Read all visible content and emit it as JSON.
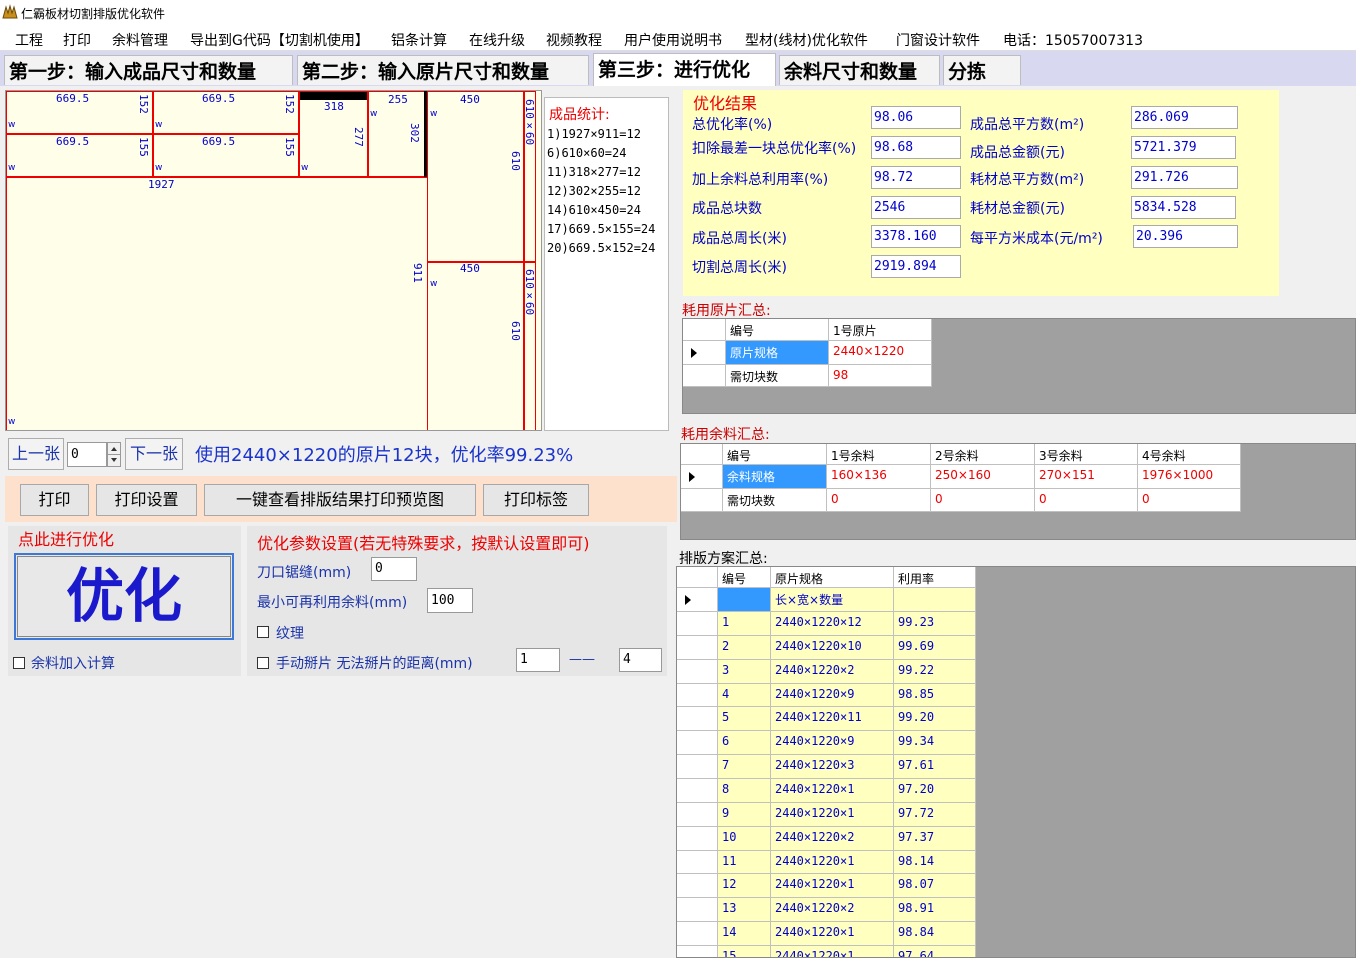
{
  "window": {
    "title": "仁霸板材切割排版优化软件"
  },
  "menu": [
    "工程",
    "打印",
    "余料管理",
    "导出到G代码【切割机使用】",
    "铝条计算",
    "在线升级",
    "视频教程",
    "用户使用说明书",
    "型材(线材)优化软件",
    "门窗设计软件",
    "电话：15057007313"
  ],
  "tabs": [
    "第一步：输入成品尺寸和数量",
    "第二步：输入原片尺寸和数量",
    "第三步：进行优化",
    "余料尺寸和数量",
    "分拣"
  ],
  "layout": {
    "dims": {
      "a": "669.5",
      "b": "152",
      "c": "669.5",
      "d": "152",
      "e": "669.5",
      "f": "155",
      "g": "669.5",
      "h": "155",
      "i": "1927",
      "j": "318",
      "k": "277",
      "l": "255",
      "m": "302",
      "n": "450",
      "o": "610×60",
      "p": "610",
      "q": "911",
      "r": "450",
      "s": "610×60",
      "t": "610"
    }
  },
  "stats": {
    "header": "成品统计:",
    "rows": [
      "1)1927×911=12",
      "6)610×60=24",
      "11)318×277=12",
      "12)302×255=12",
      "14)610×450=24",
      "17)669.5×155=24",
      "20)669.5×152=24"
    ]
  },
  "nav": {
    "prev": "上一张",
    "next": "下一张",
    "page": "0",
    "summary": "使用2440×1220的原片12块，优化率99.23%"
  },
  "print_row": {
    "print": "打印",
    "print_setup": "打印设置",
    "preview": "一键查看排版结果打印预览图",
    "print_label": "打印标签"
  },
  "optimize": {
    "group_label": "点此进行优化",
    "button": "优化",
    "leftover_label": "余料加入计算"
  },
  "params": {
    "title": "优化参数设置(若无特殊要求，按默认设置即可)",
    "kerf_label": "刀口锯缝(mm)",
    "kerf_value": "0",
    "min_reuse_label": "最小可再利用余料(mm)",
    "min_reuse_value": "100",
    "grain_label": "纹理",
    "manual_label": "手动掰片 无法掰片的距离(mm)",
    "manual_from": "1",
    "sep": "——",
    "manual_to": "4"
  },
  "result": {
    "title": "优化结果",
    "items": [
      {
        "label": "总优化率(%)",
        "value": "98.06"
      },
      {
        "label": "扣除最差一块总优化率(%)",
        "value": "98.68"
      },
      {
        "label": "加上余料总利用率(%)",
        "value": "98.72"
      },
      {
        "label": "成品总块数",
        "value": "2546"
      },
      {
        "label": "成品总周长(米)",
        "value": "3378.160"
      },
      {
        "label": "切割总周长(米)",
        "value": "2919.894"
      }
    ],
    "items2": [
      {
        "label": "成品总平方数(m²)",
        "value": "286.069"
      },
      {
        "label": "成品总金额(元)",
        "value": "5721.379"
      },
      {
        "label": "耗材总平方数(m²)",
        "value": "291.726"
      },
      {
        "label": "耗材总金额(元)",
        "value": "5834.528"
      },
      {
        "label": "每平方米成本(元/m²)",
        "value": "20.396"
      }
    ]
  },
  "sheets": {
    "title": "耗用原片汇总:",
    "headers": [
      "编号",
      "1号原片"
    ],
    "rows": [
      [
        "原片规格",
        "2440×1220"
      ],
      [
        "需切块数",
        "98"
      ]
    ]
  },
  "leftovers": {
    "title": "耗用余料汇总:",
    "headers": [
      "编号",
      "1号余料",
      "2号余料",
      "3号余料",
      "4号余料"
    ],
    "rows": [
      [
        "余料规格",
        "160×136",
        "250×160",
        "270×151",
        "1976×1000"
      ],
      [
        "需切块数",
        "0",
        "0",
        "0",
        "0"
      ]
    ]
  },
  "plans": {
    "title": "排版方案汇总:",
    "headers": [
      "编号",
      "原片规格",
      "利用率"
    ],
    "first": "长×宽×数量",
    "rows": [
      [
        "1",
        "2440×1220×12",
        "99.23"
      ],
      [
        "2",
        "2440×1220×10",
        "99.69"
      ],
      [
        "3",
        "2440×1220×2",
        "99.22"
      ],
      [
        "4",
        "2440×1220×9",
        "98.85"
      ],
      [
        "5",
        "2440×1220×11",
        "99.20"
      ],
      [
        "6",
        "2440×1220×9",
        "99.34"
      ],
      [
        "7",
        "2440×1220×3",
        "97.61"
      ],
      [
        "8",
        "2440×1220×1",
        "97.20"
      ],
      [
        "9",
        "2440×1220×1",
        "97.72"
      ],
      [
        "10",
        "2440×1220×2",
        "97.37"
      ],
      [
        "11",
        "2440×1220×1",
        "98.14"
      ],
      [
        "12",
        "2440×1220×1",
        "98.07"
      ],
      [
        "13",
        "2440×1220×2",
        "98.91"
      ],
      [
        "14",
        "2440×1220×1",
        "98.84"
      ],
      [
        "15",
        "2440×1220×1",
        "97.64"
      ]
    ]
  }
}
